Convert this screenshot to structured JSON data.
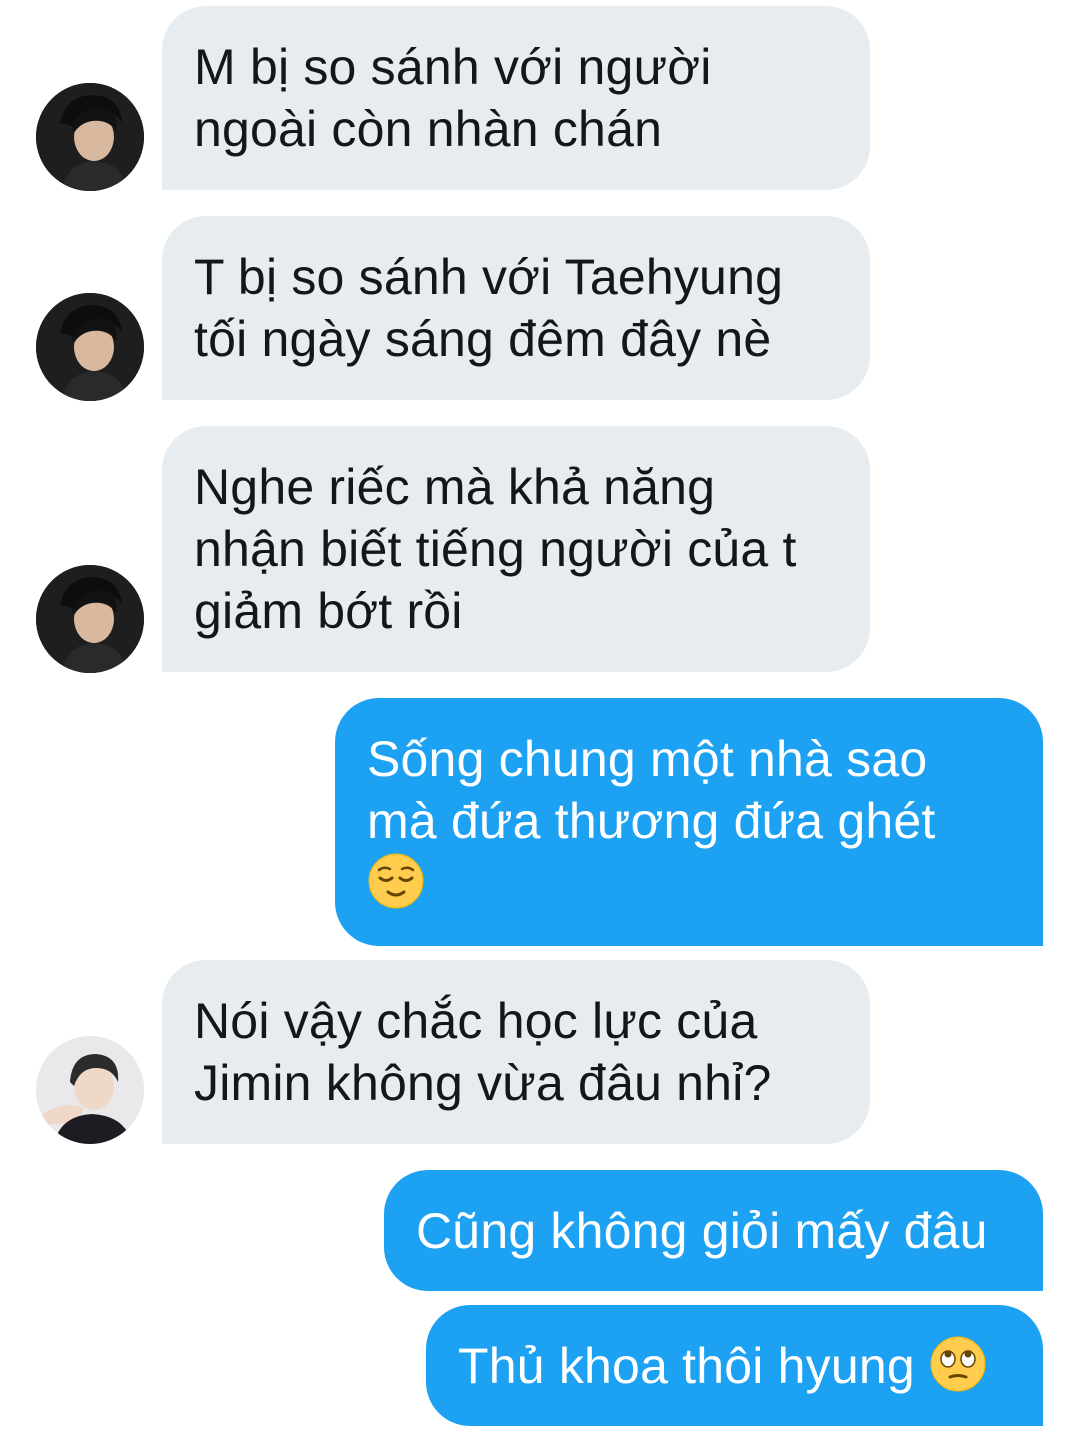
{
  "conversation": {
    "messages": [
      {
        "sender": "them",
        "lines": [
          "M bị so sánh với người",
          "ngoài còn nhàn chán"
        ]
      },
      {
        "sender": "them",
        "lines": [
          "T bị so sánh với Taehyung",
          "tối ngày sáng đêm đây nè"
        ]
      },
      {
        "sender": "them",
        "lines": [
          "Nghe riếc mà khả năng",
          "nhận biết tiếng người của t",
          "giảm bớt rồi"
        ]
      },
      {
        "sender": "me",
        "lines": [
          "Sống chung một nhà sao",
          "mà đứa thương đứa ghét"
        ],
        "emoji": "relieved-face-emoji"
      },
      {
        "sender": "them",
        "lines": [
          "Nói vậy chắc học lực của",
          "Jimin không vừa đâu nhỉ?"
        ]
      },
      {
        "sender": "me",
        "lines": [
          "Cũng không giỏi mấy đâu"
        ]
      },
      {
        "sender": "me",
        "lines": [
          "Thủ khoa thôi hyung"
        ],
        "emoji": "eye-roll-emoji"
      }
    ]
  },
  "colors": {
    "incoming_bubble": "#e6ecf0",
    "incoming_text": "#14171a",
    "outgoing_bubble": "#1da1f2",
    "outgoing_text": "#ffffff",
    "background": "#ffffff"
  }
}
